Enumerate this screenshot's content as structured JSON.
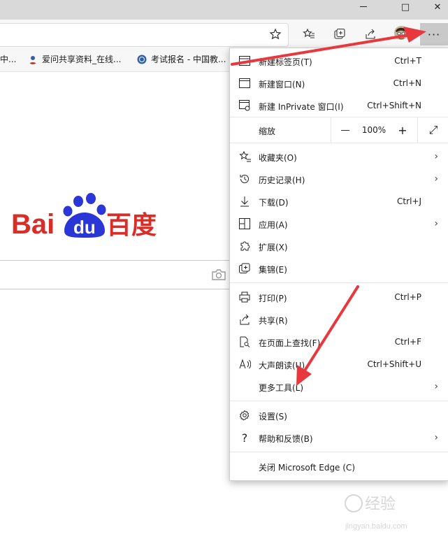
{
  "window": {
    "controls": {
      "maximize_icon": "□",
      "close_icon": "✕"
    }
  },
  "address_bar": {
    "value": ""
  },
  "toolbar": {
    "icons": [
      "star-add-icon",
      "favorites-icon",
      "collections-icon",
      "share-icon",
      "profile-avatar"
    ],
    "more_label": "···"
  },
  "favorites_bar": {
    "items": [
      {
        "label": "中..."
      },
      {
        "label": "爱问共享资料_在线..."
      },
      {
        "label": "考试报名 - 中国教..."
      }
    ]
  },
  "baidu": {
    "logo_text_left": "Bai",
    "logo_text_paw": "du",
    "logo_text_cn": "百度"
  },
  "menu": {
    "new_tab": {
      "label": "新建标签页(T)",
      "shortcut": "Ctrl+T"
    },
    "new_window": {
      "label": "新建窗口(N)",
      "shortcut": "Ctrl+N"
    },
    "new_inprivate": {
      "label": "新建 InPrivate 窗口(I)",
      "shortcut": "Ctrl+Shift+N"
    },
    "zoom": {
      "label": "缩放",
      "minus": "—",
      "value": "100%",
      "plus": "+",
      "fullscreen_icon": "⤢"
    },
    "favorites": {
      "label": "收藏夹(O)"
    },
    "history": {
      "label": "历史记录(H)"
    },
    "downloads": {
      "label": "下载(D)",
      "shortcut": "Ctrl+J"
    },
    "apps": {
      "label": "应用(A)"
    },
    "extensions": {
      "label": "扩展(X)"
    },
    "collections": {
      "label": "集锦(E)"
    },
    "print": {
      "label": "打印(P)",
      "shortcut": "Ctrl+P"
    },
    "share": {
      "label": "共享(R)"
    },
    "find": {
      "label": "在页面上查找(F)",
      "shortcut": "Ctrl+F"
    },
    "read_aloud": {
      "label": "大声朗读(U)",
      "shortcut": "Ctrl+Shift+U"
    },
    "more_tools": {
      "label": "更多工具(L)"
    },
    "settings": {
      "label": "设置(S)"
    },
    "help": {
      "label": "帮助和反馈(B)"
    },
    "close_edge": {
      "label": "关闭 Microsoft Edge (C)"
    },
    "chevron": "›"
  },
  "watermark": {
    "text_cn": "经验",
    "text_en": "jingyan.baidu.com"
  },
  "colors": {
    "baidu_red": "#d92d27",
    "baidu_blue": "#2a36d6",
    "arrow_red": "#e8383d"
  }
}
